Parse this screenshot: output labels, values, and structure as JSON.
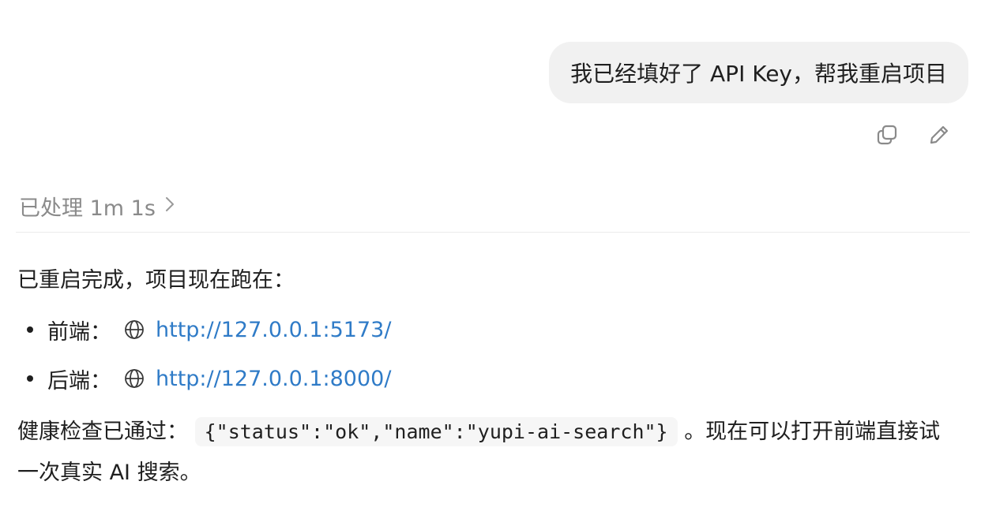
{
  "user_message": {
    "text": "我已经填好了 API Key，帮我重启项目"
  },
  "message_actions": {
    "copy_icon": "copy-icon",
    "edit_icon": "edit-icon"
  },
  "processed": {
    "label": "已处理 1m 1s",
    "icon": "chevron-right-icon"
  },
  "assistant": {
    "intro": "已重启完成，项目现在跑在：",
    "links": [
      {
        "label": "前端：",
        "icon": "globe-icon",
        "url": "http://127.0.0.1:5173/"
      },
      {
        "label": "后端：",
        "icon": "globe-icon",
        "url": "http://127.0.0.1:8000/"
      }
    ],
    "health_prefix": "健康检查已通过：",
    "health_code": "{\"status\":\"ok\",\"name\":\"yupi-ai-search\"}",
    "health_suffix": "。现在可以打开前端直接试一次真实 AI 搜索。"
  },
  "colors": {
    "link": "#2f7bc7",
    "bubble_bg": "#f1f1f1",
    "muted_text": "#8a8a8a"
  }
}
